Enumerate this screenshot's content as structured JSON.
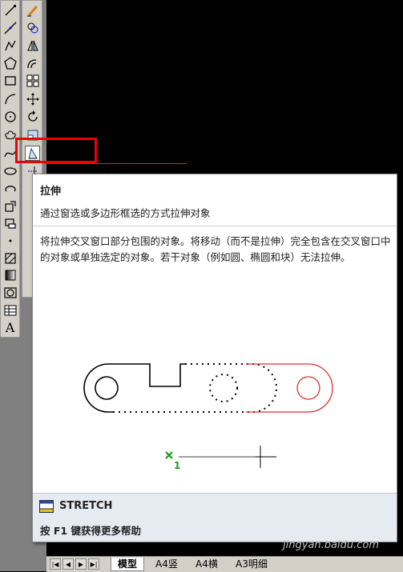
{
  "draw_toolbar": {
    "icons": [
      "line-icon",
      "construction-line-icon",
      "polyline-icon",
      "polygon-icon",
      "rectangle-icon",
      "arc-icon",
      "circle-icon",
      "revision-cloud-icon",
      "spline-icon",
      "ellipse-icon",
      "ellipse-arc-icon",
      "insert-block-icon",
      "make-block-icon",
      "point-icon",
      "hatch-icon",
      "gradient-icon",
      "region-icon",
      "table-icon",
      "multiline-text-icon"
    ],
    "text_button": "A"
  },
  "modify_toolbar": {
    "icons": [
      "erase-icon",
      "copy-icon",
      "mirror-icon",
      "offset-icon",
      "array-icon",
      "move-icon",
      "rotate-icon",
      "scale-icon",
      "stretch-icon",
      "trim-icon"
    ]
  },
  "tooltip": {
    "title": "拉伸",
    "subtitle": "通过窗选或多边形框选的方式拉伸对象",
    "description": "将拉伸交叉窗口部分包围的对象。将移动（而不是拉伸）完全包含在交叉窗口中的对象或单独选定的对象。若干对象（例如圆、椭圆和块）无法拉伸。",
    "illustration_label": "1",
    "command": "STRETCH",
    "help": "按 F1 键获得更多帮助"
  },
  "tabs": {
    "items": [
      "模型",
      "A4竖",
      "A4横",
      "A3明细"
    ],
    "active": "模型",
    "nav": [
      "|◀",
      "◀",
      "▶",
      "▶|"
    ]
  },
  "watermark": "jingyan.baidu.com",
  "colors": {
    "highlight": "#e00000",
    "stretch_preview": "#e03030",
    "base_point": "#1a9a1a"
  }
}
